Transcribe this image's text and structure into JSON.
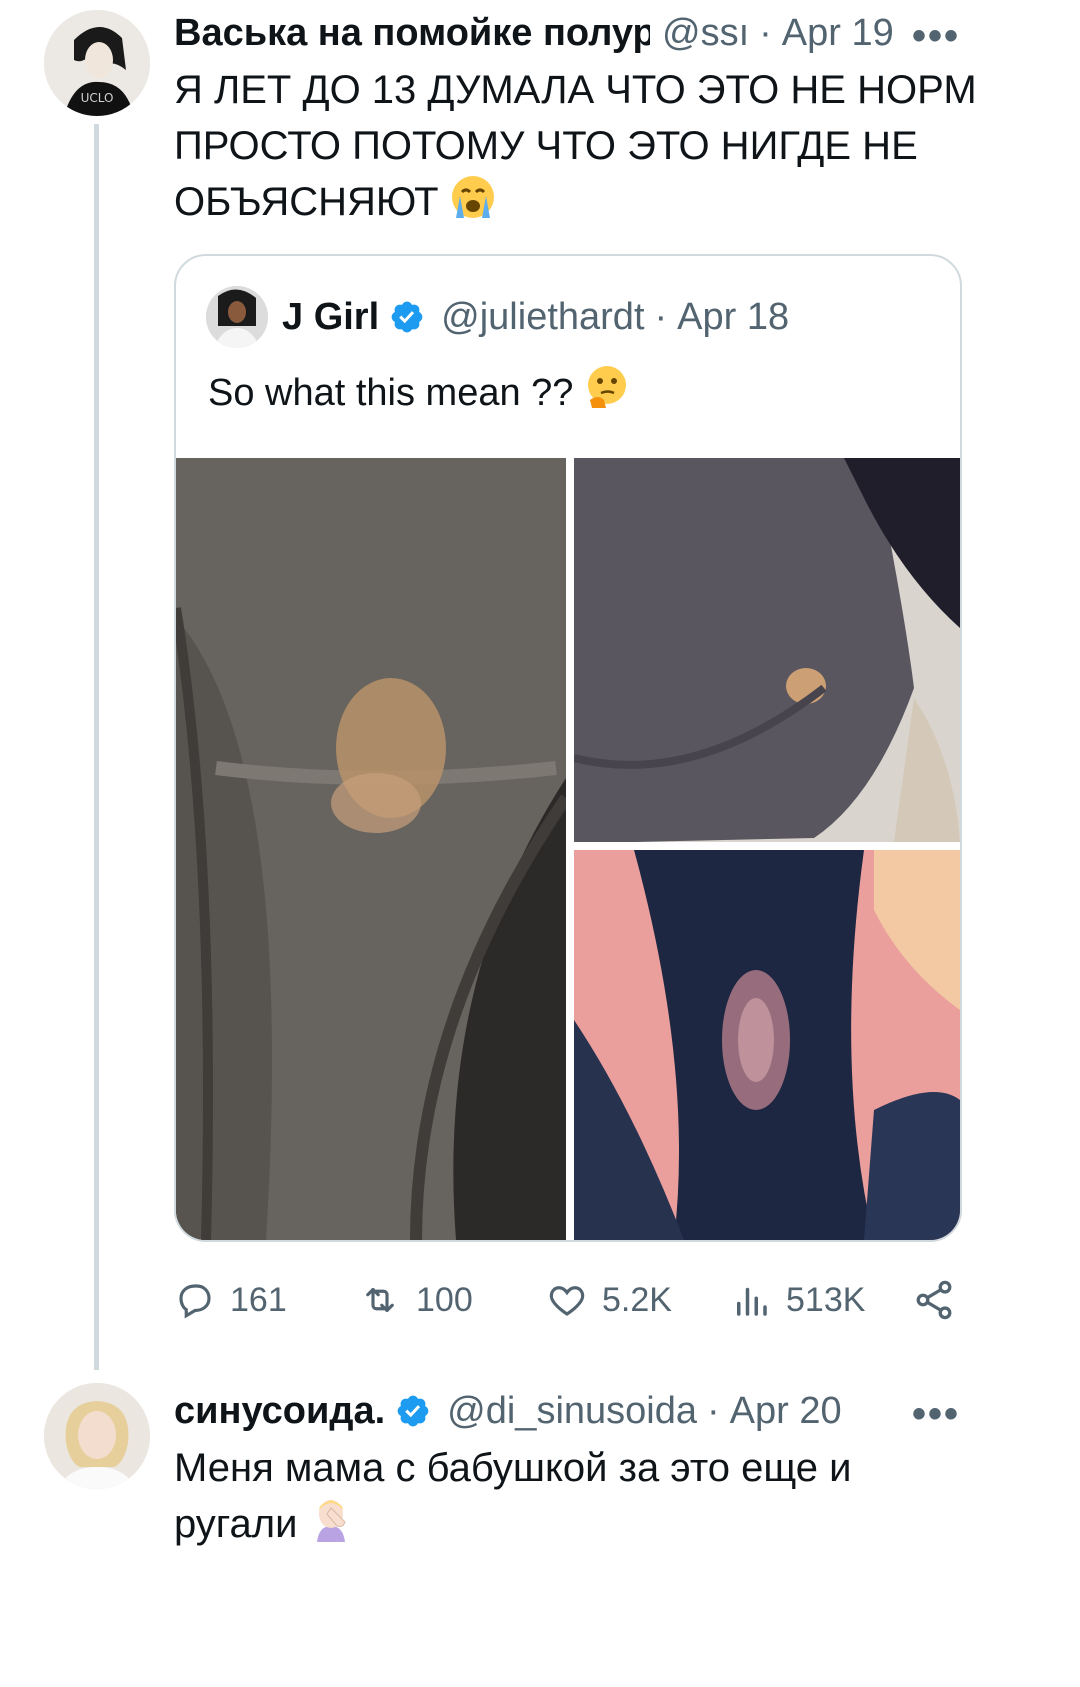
{
  "tweet1": {
    "display_name": "Васька на помойке полуре",
    "handle": "@ssı",
    "date": "Apr 19",
    "more": "•••",
    "text_line1": "Я ЛЕТ ДО 13 ДУМАЛА ЧТО ЭТО НЕ НОРМ",
    "text_line2": "ПРОСТО ПОТОМУ ЧТО ЭТО НИГДЕ НЕ",
    "text_line3": "ОБЪЯСНЯЮТ",
    "avatar_text": "UCLO",
    "emoji": "crying-face-emoji"
  },
  "quote": {
    "display_name": "J Girl",
    "handle": "@juliethardt",
    "separator": "·",
    "date": "Apr 18",
    "text": "So what this mean ??",
    "emoji": "thinking-face-emoji",
    "photos": [
      "photo-gray-underwear-1",
      "photo-gray-underwear-2",
      "photo-navy-underwear"
    ]
  },
  "actions": {
    "replies": "161",
    "reposts": "100",
    "likes": "5.2K",
    "views": "513K"
  },
  "tweet2": {
    "display_name": "синусоида.",
    "handle": "@di_sinusoida",
    "separator": "·",
    "date": "Apr 20",
    "more": "•••",
    "text_line1": "Меня мама с бабушкой за это еще и",
    "text_line2": "ругали",
    "emoji": "person-facepalming-emoji"
  },
  "colors": {
    "verified": "#1d9bf0",
    "muted": "#536471",
    "border": "#cfd9de"
  }
}
